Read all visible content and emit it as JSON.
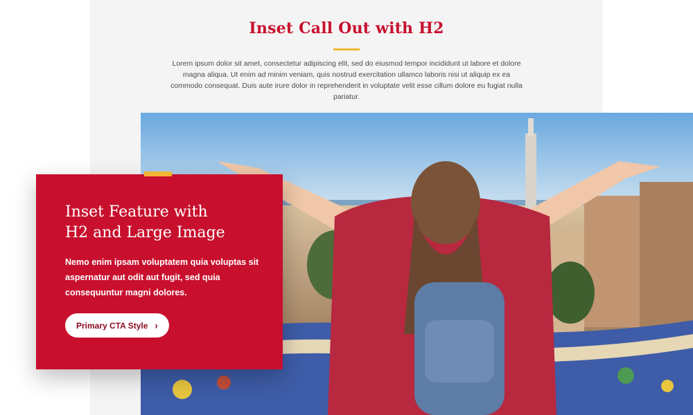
{
  "callout": {
    "title": "Inset Call Out with H2",
    "body": "Lorem ipsum dolor sit amet, consectetur adipiscing elit, sed do eiusmod tempor incididunt ut labore et dolore magna aliqua. Ut enim ad minim veniam, quis nostrud exercitation ullamco laboris nisi ut aliquip ex ea commodo consequat. Duis aute irure dolor in reprehenderit in voluptate velit esse cillum dolore eu fugiat nulla pariatur."
  },
  "feature": {
    "title_line1": "Inset Feature with",
    "title_line2": "H2 and Large Image",
    "body": "Nemo enim ipsam voluptatem quia voluptas sit aspernatur aut odit aut fugit, sed quia consequuntur magni dolores.",
    "cta_label": "Primary CTA Style",
    "cta_icon": "chevron-right-icon"
  },
  "colors": {
    "brand_red": "#c8102e",
    "accent_gold": "#f2b632",
    "panel_gray": "#f4f4f4",
    "cta_text": "#8b0a1e"
  }
}
